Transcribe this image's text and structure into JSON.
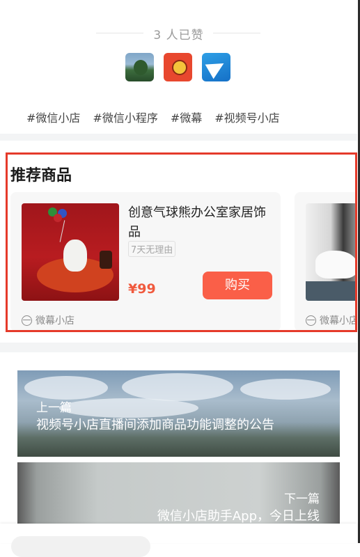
{
  "likes": {
    "text": "3 人已赞"
  },
  "tags": [
    "#微信小店",
    "#微信小程序",
    "#微幕",
    "#视频号小店"
  ],
  "recommend": {
    "title": "推荐商品",
    "products": [
      {
        "name": "创意气球熊办公室家居饰品",
        "badge": "7天无理由",
        "price": "¥99",
        "buy_label": "购买",
        "store": "微幕小店"
      },
      {
        "store": "微幕小店"
      }
    ]
  },
  "navigation": {
    "prev_label": "上一篇",
    "prev_title": "视频号小店直播间添加商品功能调整的公告",
    "next_label": "下一篇",
    "next_title": "微信小店助手App，今日上线"
  }
}
